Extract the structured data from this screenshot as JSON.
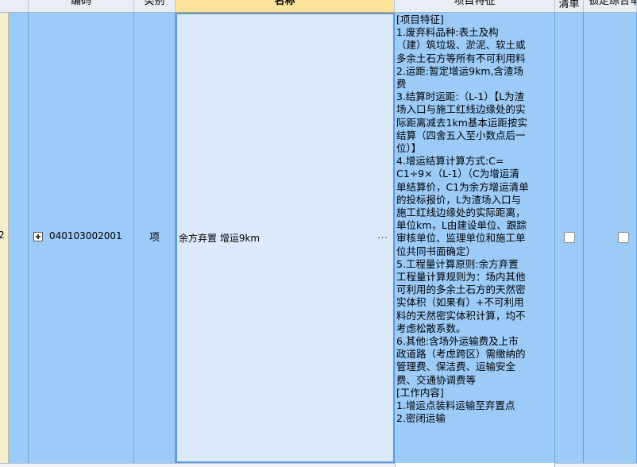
{
  "header": {
    "code": "编码",
    "category": "类别",
    "name": "名称",
    "feature": "项目特征",
    "list": "清单",
    "lock": "锁定综合单"
  },
  "row": {
    "index": "2",
    "code": "040103002001",
    "category": "项",
    "name": "余方弃置 增运9km",
    "name_more": "…",
    "feature_text": "[项目特征]\n1.废弃料品种:表土及构\n（建）筑垃圾、淤泥、软土或\n多余土石方等所有不可利用料\n2.运距:暂定增运9km,含渣场\n费\n3.结算时运距:（L-1）【L为渣\n场入口与施工红线边缘处的实\n际距离减去1km基本运距按实\n结算（四舍五入至小数点后一\n位）】\n4.增运结算计算方式:C=\nC1÷9×（L-1）（C为增运清\n单结算价，C1为余方增运清单\n的投标报价，L为渣场入口与\n施工红线边缘处的实际距离，\n单位km，L由建设单位、跟踪\n审核单位、监理单位和施工单\n位共同书面确定）\n5.工程量计算原则:余方弃置\n工程量计算规则为：场内其他\n可利用的多余土石方的天然密\n实体积（如果有）+不可利用\n料的天然密实体积计算，均不\n考虑松散系数。\n6.其他:含场外运输费及上市\n政道路（考虑跨区）需缴纳的\n管理费、保洁费、运输安全\n费、交通协调费等\n[工作内容]\n1.增运点装料运输至弃置点\n2.密闭运输",
    "list_checked": false,
    "lock_checked": false
  },
  "colors": {
    "row_blue": "#9ccbf7",
    "selected_cell": "#dce9fb",
    "selected_border": "#5a9ae8",
    "header_selected": "#fde49a"
  }
}
